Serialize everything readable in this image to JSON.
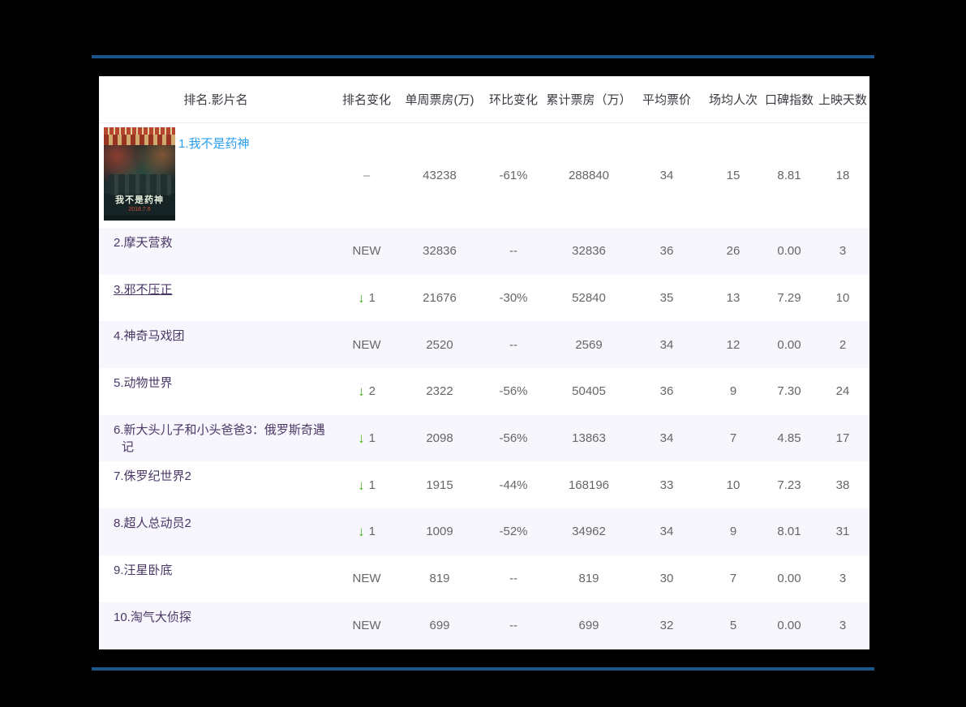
{
  "page": {
    "background_color": "#000000",
    "rule_color": "#1a568c",
    "link_blue": "#2b9ff0",
    "link_purple": "#4a3766",
    "down_arrow_green": "#49b01e",
    "alt_row_background": "#f7f6fd"
  },
  "poster": {
    "title": "我不是药神",
    "date": "2018.7.6"
  },
  "table": {
    "columns": [
      "排名.影片名",
      "排名变化",
      "单周票房(万)",
      "环比变化",
      "累计票房（万）",
      "平均票价",
      "场均人次",
      "口碑指数",
      "上映天数"
    ],
    "change_labels": {
      "same": "–",
      "new": "NEW",
      "down_arrow": "↓"
    },
    "rows": [
      {
        "title": "1.我不是药神",
        "title_style": "blue",
        "underline": false,
        "poster": true,
        "change": {
          "kind": "same"
        },
        "values": [
          "43238",
          "-61%",
          "288840",
          "34",
          "15",
          "8.81",
          "18"
        ]
      },
      {
        "title": "2.摩天营救",
        "title_style": "purple",
        "underline": false,
        "poster": false,
        "change": {
          "kind": "new"
        },
        "values": [
          "32836",
          "--",
          "32836",
          "36",
          "26",
          "0.00",
          "3"
        ]
      },
      {
        "title": "3.邪不压正",
        "title_style": "purple",
        "underline": true,
        "poster": false,
        "change": {
          "kind": "down",
          "amount": "1"
        },
        "values": [
          "21676",
          "-30%",
          "52840",
          "35",
          "13",
          "7.29",
          "10"
        ]
      },
      {
        "title": "4.神奇马戏团",
        "title_style": "purple",
        "underline": false,
        "poster": false,
        "change": {
          "kind": "new"
        },
        "values": [
          "2520",
          "--",
          "2569",
          "34",
          "12",
          "0.00",
          "2"
        ]
      },
      {
        "title": "5.动物世界",
        "title_style": "purple",
        "underline": false,
        "poster": false,
        "change": {
          "kind": "down",
          "amount": "2"
        },
        "values": [
          "2322",
          "-56%",
          "50405",
          "36",
          "9",
          "7.30",
          "24"
        ]
      },
      {
        "title": "6.新大头儿子和小头爸爸3：俄罗斯奇遇记",
        "title_style": "purple",
        "underline": false,
        "poster": false,
        "change": {
          "kind": "down",
          "amount": "1"
        },
        "values": [
          "2098",
          "-56%",
          "13863",
          "34",
          "7",
          "4.85",
          "17"
        ]
      },
      {
        "title": "7.侏罗纪世界2",
        "title_style": "purple",
        "underline": false,
        "poster": false,
        "change": {
          "kind": "down",
          "amount": "1"
        },
        "values": [
          "1915",
          "-44%",
          "168196",
          "33",
          "10",
          "7.23",
          "38"
        ]
      },
      {
        "title": "8.超人总动员2",
        "title_style": "purple",
        "underline": false,
        "poster": false,
        "change": {
          "kind": "down",
          "amount": "1"
        },
        "values": [
          "1009",
          "-52%",
          "34962",
          "34",
          "9",
          "8.01",
          "31"
        ]
      },
      {
        "title": "9.汪星卧底",
        "title_style": "purple",
        "underline": false,
        "poster": false,
        "change": {
          "kind": "new"
        },
        "values": [
          "819",
          "--",
          "819",
          "30",
          "7",
          "0.00",
          "3"
        ]
      },
      {
        "title": "10.淘气大侦探",
        "title_style": "purple",
        "underline": false,
        "poster": false,
        "change": {
          "kind": "new"
        },
        "values": [
          "699",
          "--",
          "699",
          "32",
          "5",
          "0.00",
          "3"
        ]
      }
    ]
  }
}
